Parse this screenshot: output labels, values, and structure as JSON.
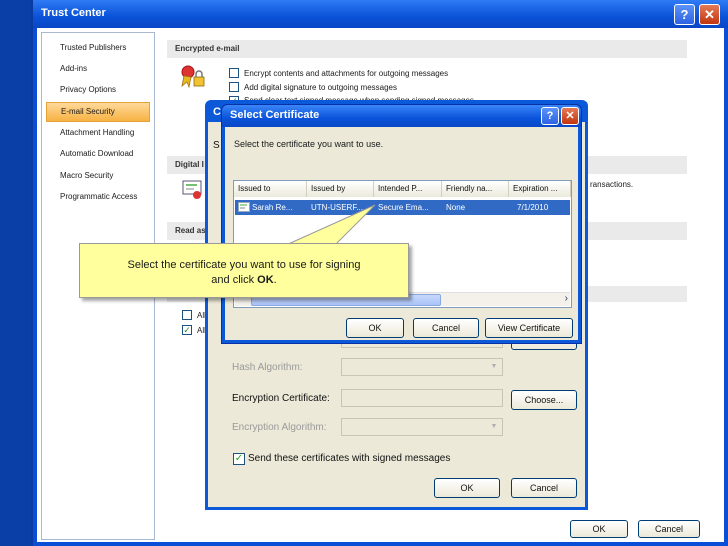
{
  "trust_center": {
    "title": "Trust Center",
    "help_symbol": "?",
    "close_symbol": "✕",
    "nav": [
      "Trusted Publishers",
      "Add-ins",
      "Privacy Options",
      "E-mail Security",
      "Attachment Handling",
      "Automatic Download",
      "Macro Security",
      "Programmatic Access"
    ],
    "sections": {
      "encrypted_email": "Encrypted e-mail",
      "digital_ids": "Digital I",
      "read_as": "Read as"
    },
    "encrypt_options": [
      "Encrypt contents and attachments for outgoing messages",
      "Add digital signature to outgoing messages",
      "Send clear text signed message when sending signed messages"
    ],
    "digital_ids_text": "ransactions.",
    "al_options": [
      "All",
      "All"
    ],
    "ok_label": "OK",
    "cancel_label": "Cancel"
  },
  "settings_dialog": {
    "title_fragment": "C",
    "partial_label": "S",
    "hash_algorithm_label": "Hash Algorithm:",
    "encryption_certificate_label": "Encryption Certificate:",
    "encryption_algorithm_label": "Encryption Algorithm:",
    "send_certificates_label": "Send these certificates with signed messages",
    "send_certificates_checked": true,
    "choose_label": "Choose...",
    "ok_label": "OK",
    "cancel_label": "Cancel"
  },
  "select_certificate": {
    "title": "Select Certificate",
    "help_symbol": "?",
    "close_symbol": "✕",
    "instruction": "Select the certificate you want to use.",
    "columns": [
      "Issued to",
      "Issued by",
      "Intended P...",
      "Friendly na...",
      "Expiration ..."
    ],
    "rows": [
      {
        "issued_to": "Sarah Re...",
        "issued_by": "UTN-USERF...",
        "intended": "Secure Ema...",
        "friendly": "None",
        "expiration": "7/1/2010"
      }
    ],
    "ok_label": "OK",
    "cancel_label": "Cancel",
    "view_certificate_label": "View Certificate"
  },
  "callout": {
    "line1": "Select the certificate you want to use for signing",
    "line2_prefix": "and click ",
    "line2_bold": "OK",
    "line2_suffix": "."
  },
  "colors": {
    "desktop_blue": "#0b3fa8",
    "selection_blue": "#316ac5",
    "nav_selected": "#f7b243",
    "callout_yellow": "#ffff9e"
  }
}
